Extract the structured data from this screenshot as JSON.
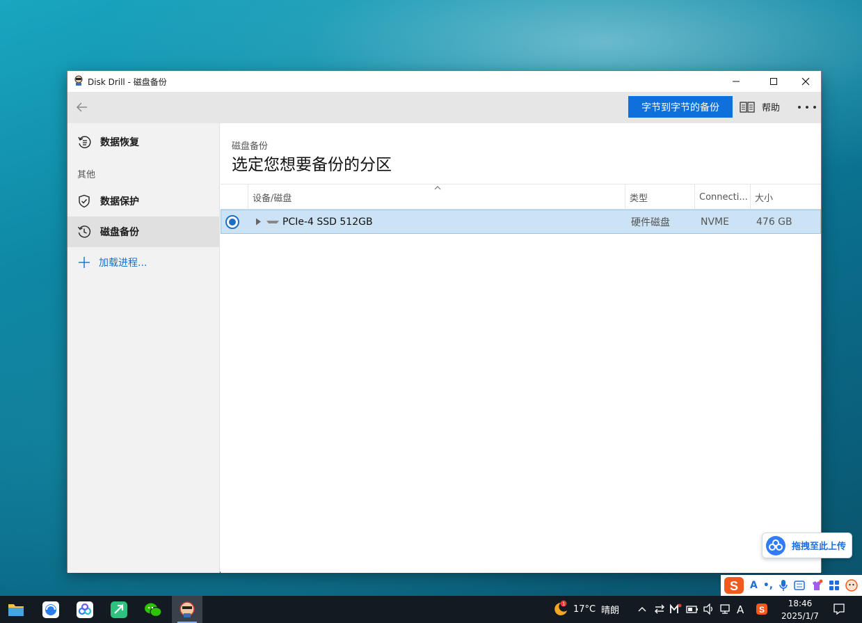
{
  "window": {
    "title": "Disk Drill - 磁盘备份"
  },
  "toolbar": {
    "primary_button": "字节到字节的备份",
    "help_label": "帮助"
  },
  "sidebar": {
    "items": [
      {
        "label": "数据恢复",
        "icon": "restore-icon",
        "active": false
      },
      {
        "label": "数据保护",
        "icon": "shield-icon",
        "active": false
      },
      {
        "label": "磁盘备份",
        "icon": "clock-icon",
        "active": true
      }
    ],
    "section_label": "其他",
    "add_label": "加载进程..."
  },
  "main": {
    "breadcrumb": "磁盘备份",
    "heading": "选定您想要备份的分区",
    "columns": [
      "设备/磁盘",
      "类型",
      "Connecti...",
      "大小"
    ],
    "rows": [
      {
        "name": "PCIe-4 SSD 512GB",
        "type": "硬件磁盘",
        "connection": "NVME",
        "size": "476 GB",
        "selected": true
      }
    ]
  },
  "upload_widget": {
    "label": "拖拽至此上传"
  },
  "ime_bar": {
    "mode": "A",
    "punct": "•,"
  },
  "taskbar": {
    "weather_temp": "17°C",
    "weather_desc": "晴朗",
    "ime_indicator": "A",
    "time": "18:46",
    "date": "2025/1/7"
  }
}
